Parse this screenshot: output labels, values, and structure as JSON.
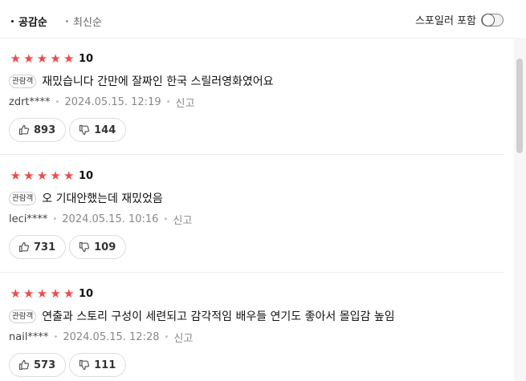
{
  "sort": {
    "active": "공감순",
    "inactive": "최신순"
  },
  "spoiler": {
    "label": "스포일러 포함",
    "enabled": false
  },
  "colors": {
    "star": "#ee4a4a",
    "divider": "#ececec"
  },
  "reviews": [
    {
      "stars": "★★★★★",
      "score": "10",
      "badge": "관람객",
      "text": "재밌습니다 간만에 잘짜인 한국 스릴러영화였어요",
      "user": "zdrt****",
      "date": "2024.05.15. 12:19",
      "report": "신고",
      "likes": "893",
      "dislikes": "144"
    },
    {
      "stars": "★★★★★",
      "score": "10",
      "badge": "관람객",
      "text": "오 기대안했는데 재밌었음",
      "user": "leci****",
      "date": "2024.05.15. 10:16",
      "report": "신고",
      "likes": "731",
      "dislikes": "109"
    },
    {
      "stars": "★★★★★",
      "score": "10",
      "badge": "관람객",
      "text": "연출과 스토리 구성이 세련되고 감각적임 배우들 연기도 좋아서 몰입감 높임",
      "user": "nail****",
      "date": "2024.05.15. 12:28",
      "report": "신고",
      "likes": "573",
      "dislikes": "111"
    }
  ],
  "icons": {
    "like": "thumbs-up-icon",
    "dislike": "thumbs-down-icon"
  }
}
